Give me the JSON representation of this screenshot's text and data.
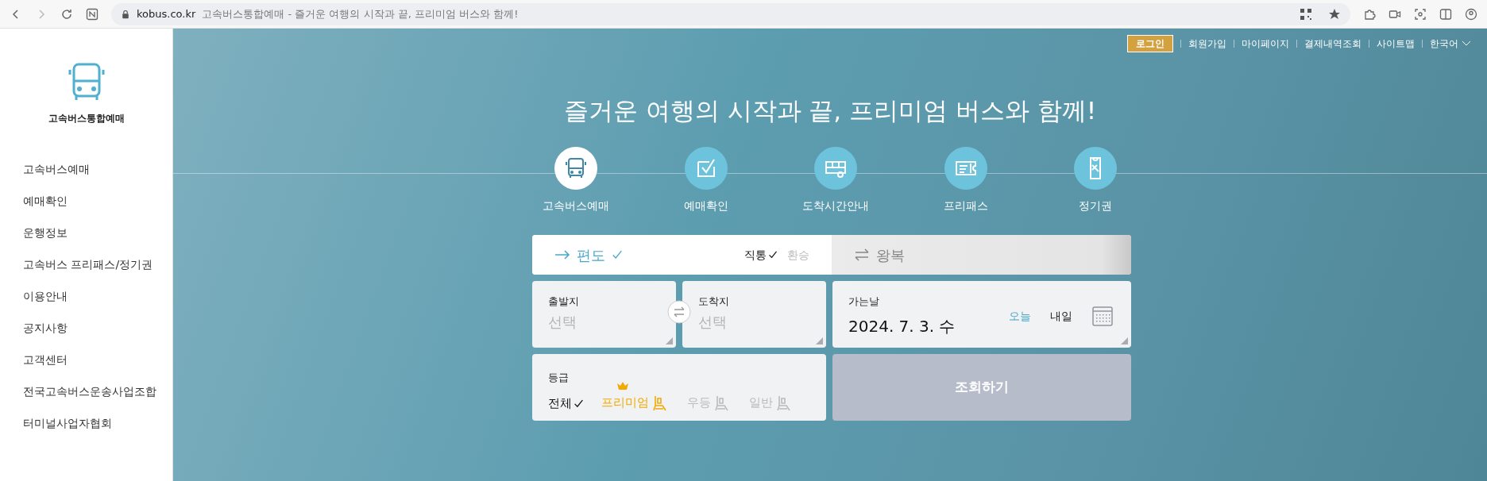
{
  "browser": {
    "domain": "kobus.co.kr",
    "page_title": "고속버스통합예매 - 즐거운 여행의 시작과 끝, 프리미엄 버스와 함께!"
  },
  "sidebar": {
    "logo_text": "고속버스통합예매",
    "items": [
      "고속버스예매",
      "예매확인",
      "운행정보",
      "고속버스 프리패스/정기권",
      "이용안내",
      "공지사항",
      "고객센터",
      "전국고속버스운송사업조합",
      "터미널사업자협회"
    ]
  },
  "top_links": [
    {
      "label": "로그인",
      "kind": "button"
    },
    {
      "label": "회원가입",
      "kind": "link"
    },
    {
      "label": "마이페이지",
      "kind": "link"
    },
    {
      "label": "결제내역조회",
      "kind": "link"
    },
    {
      "label": "사이트맵",
      "kind": "link"
    },
    {
      "label": "한국어",
      "kind": "dropdown"
    }
  ],
  "headline": "즐거운 여행의 시작과 끝, 프리미엄 버스와 함께!",
  "services": [
    {
      "label": "고속버스예매",
      "selected": true
    },
    {
      "label": "예매확인",
      "selected": false
    },
    {
      "label": "도착시간안내",
      "selected": false
    },
    {
      "label": "프리패스",
      "selected": false
    },
    {
      "label": "정기권",
      "selected": false
    }
  ],
  "trip_types": [
    {
      "label": "편도",
      "selected": true
    },
    {
      "label": "왕복",
      "selected": false
    }
  ],
  "route_options": [
    {
      "label": "직통",
      "selected": true
    },
    {
      "label": "환승",
      "selected": false
    }
  ],
  "departure": {
    "label": "출발지",
    "placeholder": "선택"
  },
  "arrival": {
    "label": "도착지",
    "placeholder": "선택"
  },
  "date": {
    "label": "가는날",
    "value": "2024. 7. 3. 수",
    "quick": [
      {
        "label": "오늘",
        "selected": true
      },
      {
        "label": "내일",
        "selected": false
      }
    ]
  },
  "grade": {
    "label": "등급",
    "options": [
      {
        "label": "전체",
        "selected": true,
        "kind": "plain"
      },
      {
        "label": "프리미엄",
        "selected": false,
        "kind": "premium"
      },
      {
        "label": "우등",
        "selected": false,
        "kind": "seat"
      },
      {
        "label": "일반",
        "selected": false,
        "kind": "seat"
      }
    ]
  },
  "search_button": "조회하기"
}
